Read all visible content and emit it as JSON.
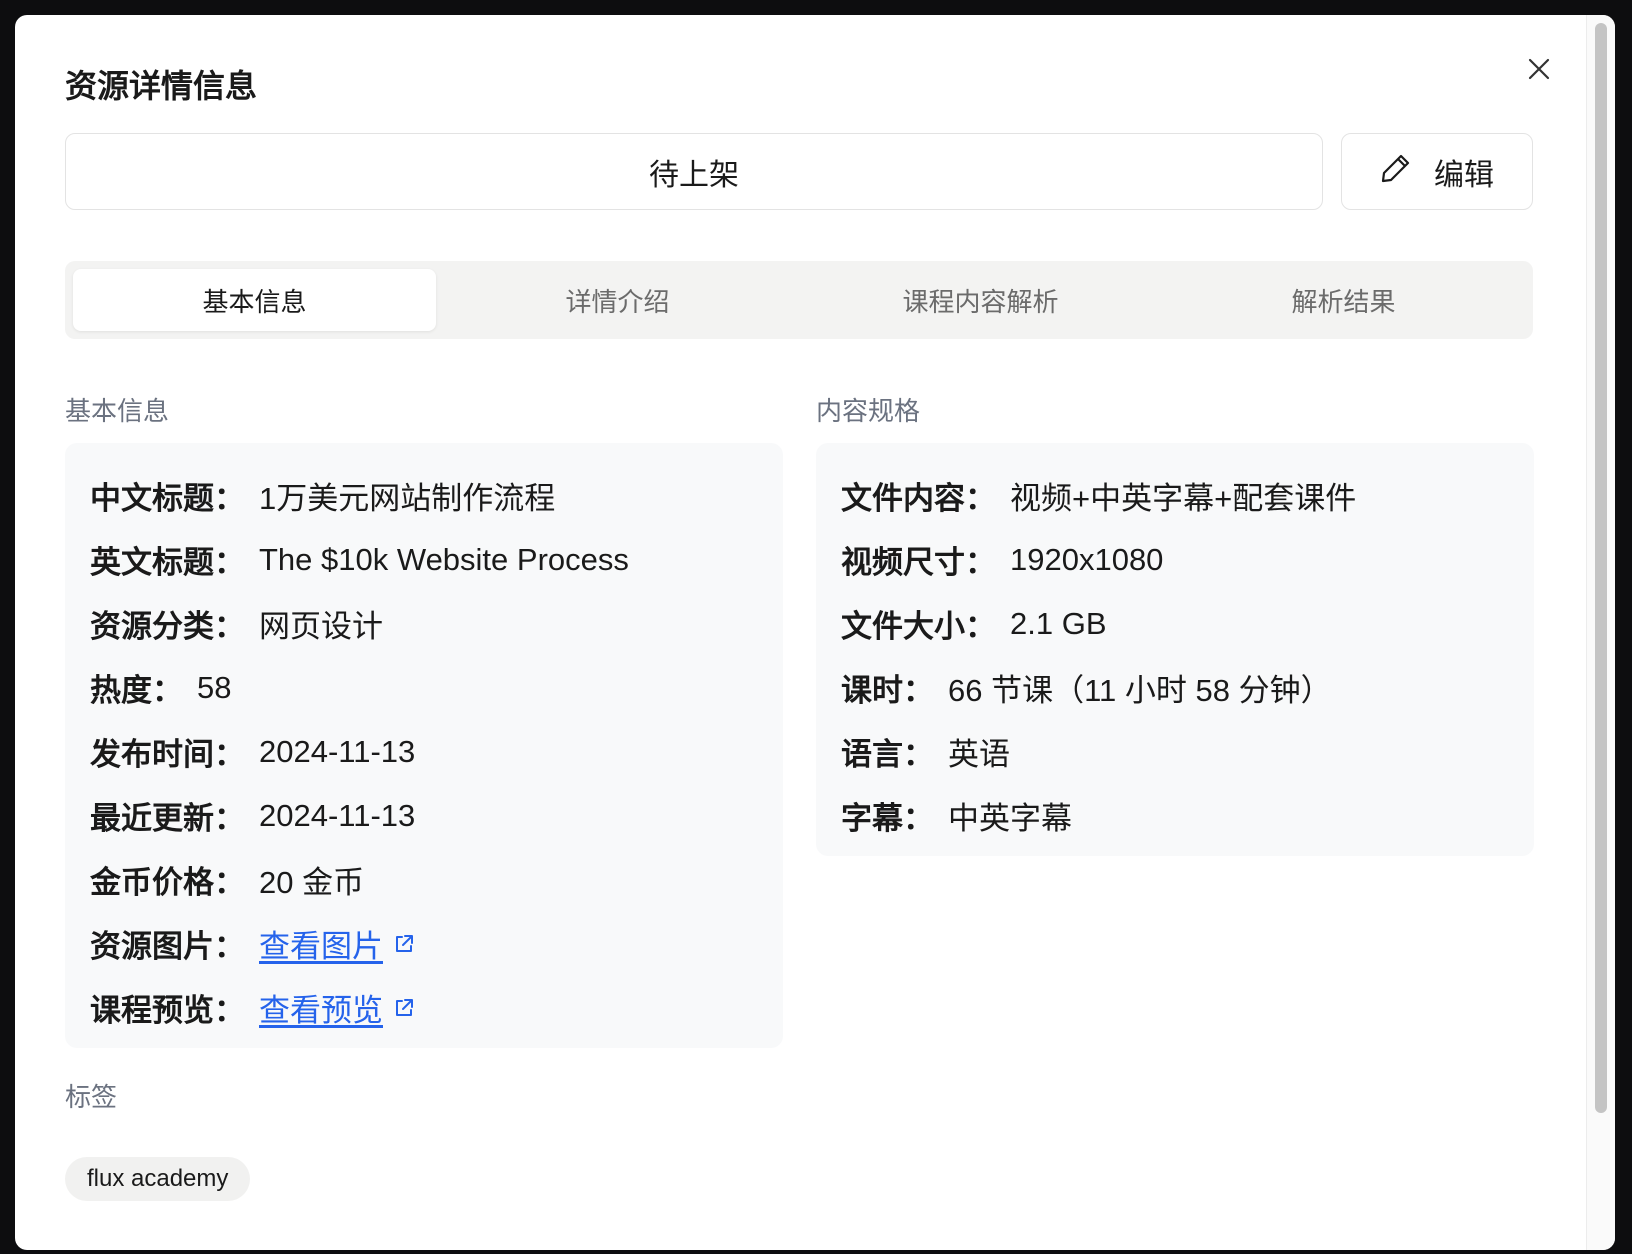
{
  "modal": {
    "title": "资源详情信息",
    "status": "待上架",
    "edit_label": "编辑"
  },
  "tabs": [
    {
      "label": "基本信息",
      "active": true
    },
    {
      "label": "详情介绍",
      "active": false
    },
    {
      "label": "课程内容解析",
      "active": false
    },
    {
      "label": "解析结果",
      "active": false
    }
  ],
  "basic": {
    "section_title": "基本信息",
    "rows": [
      {
        "key": "中文标题：",
        "value": "1万美元网站制作流程"
      },
      {
        "key": "英文标题：",
        "value": "The $10k Website Process"
      },
      {
        "key": "资源分类：",
        "value": "网页设计"
      },
      {
        "key": "热度：",
        "value": "58"
      },
      {
        "key": "发布时间：",
        "value": "2024-11-13"
      },
      {
        "key": "最近更新：",
        "value": "2024-11-13"
      },
      {
        "key": "金币价格：",
        "value": "20 金币"
      },
      {
        "key": "资源图片：",
        "value": "查看图片"
      },
      {
        "key": "课程预览：",
        "value": "查看预览"
      }
    ]
  },
  "spec": {
    "section_title": "内容规格",
    "rows": [
      {
        "key": "文件内容：",
        "value": "视频+中英字幕+配套课件"
      },
      {
        "key": "视频尺寸：",
        "value": "1920x1080"
      },
      {
        "key": "文件大小：",
        "value": "2.1 GB"
      },
      {
        "key": "课时：",
        "value": "66 节课（11 小时 58 分钟）"
      },
      {
        "key": "语言：",
        "value": "英语"
      },
      {
        "key": "字幕：",
        "value": "中英字幕"
      }
    ]
  },
  "tags": {
    "section_title": "标签",
    "items": [
      "flux academy"
    ]
  },
  "colors": {
    "link": "#2563eb",
    "panel_bg": "#f8f9fa",
    "tab_bg": "#f3f3f2"
  }
}
